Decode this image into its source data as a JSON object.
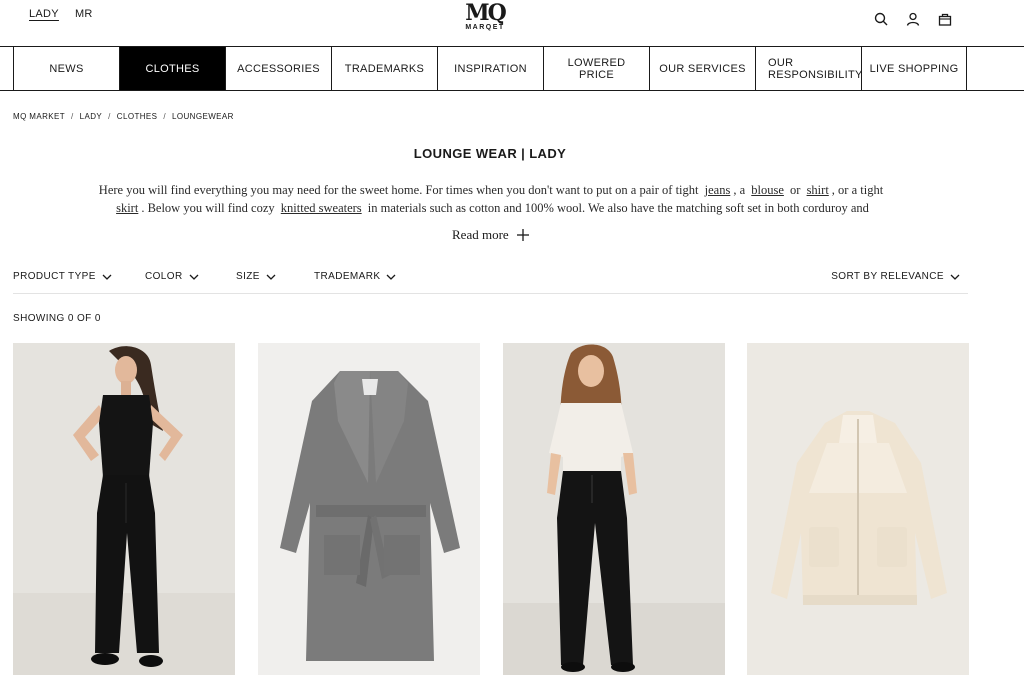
{
  "header": {
    "gender_links": [
      "LADY",
      "MR"
    ],
    "logo": {
      "mark": "MQ",
      "word": "MARQET"
    },
    "icons": [
      "search-icon",
      "user-icon",
      "bag-icon"
    ]
  },
  "nav": {
    "items": [
      "NEWS",
      "CLOTHES",
      "ACCESSORIES",
      "TRADEMARKS",
      "INSPIRATION",
      "LOWERED PRICE",
      "OUR SERVICES",
      "OUR RESPONSIBILITY",
      "LIVE SHOPPING"
    ],
    "active": "CLOTHES"
  },
  "breadcrumb": [
    "MQ MARKET",
    "LADY",
    "CLOTHES",
    "LOUNGEWEAR"
  ],
  "page": {
    "title": "LOUNGE WEAR | LADY",
    "intro": {
      "t1": "Here you will find everything you may need for the sweet home. For times when you don't want to put on a pair of tight",
      "l1": "jeans",
      "t2": ", a",
      "l2": "blouse",
      "t3": "or",
      "l3": "shirt",
      "t4": ", or a tight",
      "l4": "skirt",
      "t5": ". Below you will find cozy",
      "l5": "knitted sweaters",
      "t6": "in materials such as cotton and 100% wool. We also have the matching soft set in both corduroy and organic"
    },
    "read_more": "Read more"
  },
  "filters": {
    "product_type": "PRODUCT TYPE",
    "color": "COLOR",
    "size": "SIZE",
    "trademark": "TRADEMARK",
    "sort": "SORT BY RELEVANCE"
  },
  "showing": "SHOWING 0 OF 0",
  "products": [
    {
      "name": "black-tank-trousers-model"
    },
    {
      "name": "grey-terry-bathrobe"
    },
    {
      "name": "white-tee-black-trousers-model"
    },
    {
      "name": "cream-fleece-jacket"
    }
  ],
  "colors": {
    "text": "#1a1a1a",
    "nav_active_bg": "#000000",
    "image_bg": "#e6e4df"
  }
}
